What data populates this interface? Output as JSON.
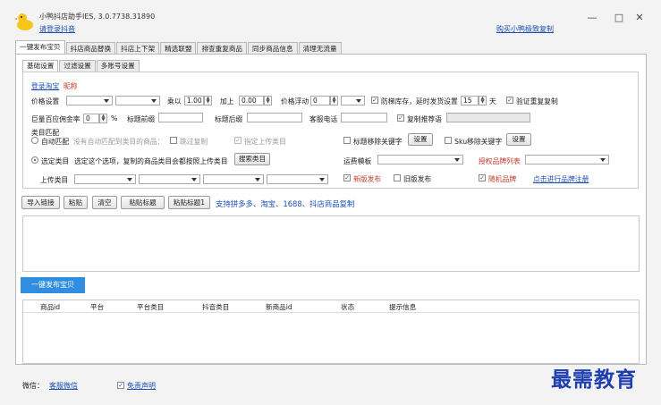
{
  "window": {
    "title": "小鸭抖店助手IES, 3.0.7738.31890",
    "login_link": "请登录抖音",
    "buy_link": "购买小鸭极致复制",
    "minimize": "—",
    "maximize": "□",
    "close": "✕"
  },
  "tabs": [
    "一键发布宝贝",
    "抖店商品替换",
    "抖店上下架",
    "精选联盟",
    "排查重复商品",
    "同步商品信息",
    "清理无流量"
  ],
  "subtabs": [
    "基础设置",
    "过滤设置",
    "多账号设置"
  ],
  "basic": {
    "login_text": "登录淘宝",
    "nickname": "昵称",
    "price_setting": "价格设置",
    "multiply": "乘以",
    "multiply_value": "1.00",
    "add": "加上",
    "add_value": "0.00",
    "float_label": "价格浮动",
    "float_value": "0",
    "stock_label": "防梯库存，延时发货设置",
    "delay_value": "15",
    "day": "天",
    "verify_dup": "验证重复复制",
    "commission_label": "巨量百应佣金率",
    "commission_value": "0",
    "percent": "%",
    "title_prefix": "标题前缀",
    "title_suffix": "标题后缀",
    "service_phone": "客服电话",
    "copy_recommend": "复制推荐语"
  },
  "category": {
    "section_label": "类目匹配",
    "auto_match": "自动匹配",
    "auto_hint": "没有自动匹配到类目的商品：",
    "skip_copy": "跳过复制",
    "assign_upload": "指定上传类目",
    "select_category": "选定类目",
    "select_hint": "选定这个选项，复制的商品类目会都按照上传类目",
    "search_category": "搜索类目",
    "upload_category": "上传类目"
  },
  "right_options": {
    "title_remove_kw": "标题移除关键字",
    "settings_1": "设置",
    "sku_remove_kw": "Sku移除关键字",
    "settings_2": "设置",
    "shipping_template": "运费模板",
    "new_publish": "新版发布",
    "old_publish": "旧版发布",
    "brand_list": "授权品牌列表",
    "random_brand": "随机品牌",
    "register_brand": "点击进行品牌注册"
  },
  "toolbar": {
    "import_links": "导入链接",
    "paste": "粘贴",
    "clear": "清空",
    "paste_title": "粘贴标题",
    "paste_title_1": "粘贴标题1",
    "support_text": "支持拼多多、淘宝、1688、抖店商品复制"
  },
  "publish_button": "一键发布宝贝",
  "table": {
    "columns": [
      "商品id",
      "平台",
      "平台类目",
      "抖音类目",
      "新商品id",
      "状态",
      "提示信息"
    ]
  },
  "footer": {
    "wechat_label": "微信：",
    "wechat_link": "客服微信",
    "disclaimer": "免责声明"
  },
  "watermark": "最需教育",
  "colors": {
    "accent": "#2f8ee0",
    "link": "#1a4fb3",
    "warning_red": "#c0392b"
  }
}
